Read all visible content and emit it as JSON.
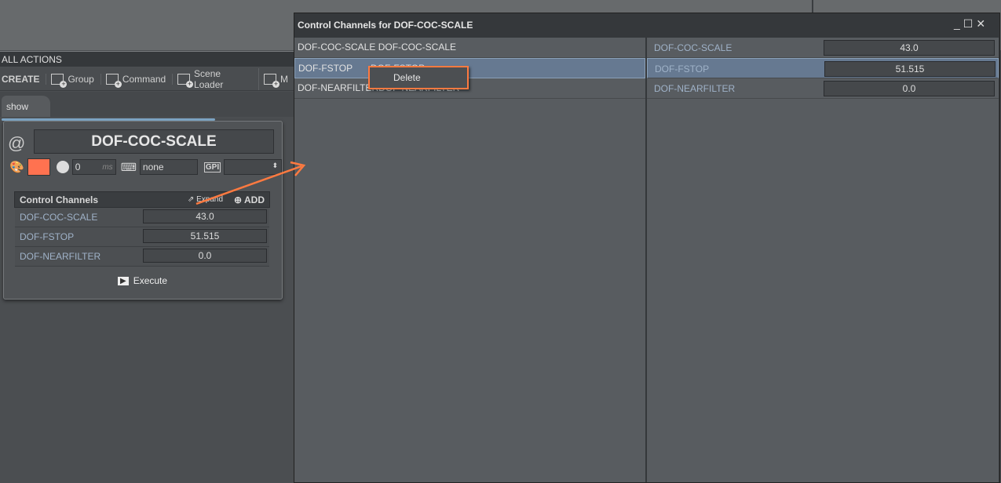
{
  "left": {
    "section_title": "ALL ACTIONS",
    "toolbar": {
      "create": "CREATE",
      "items": [
        {
          "label": "Group",
          "icon": "group-add-icon"
        },
        {
          "label": "Command",
          "icon": "command-add-icon"
        },
        {
          "label": "Scene Loader",
          "icon": "scene-loader-add-icon"
        },
        {
          "label": "M",
          "icon": "media-add-icon"
        }
      ]
    },
    "tab": "show",
    "card": {
      "title": "DOF-COC-SCALE",
      "color": "#ff7250",
      "delay": "0",
      "delay_unit": "ms",
      "shortcut": "none",
      "gpi_label": "GPI",
      "gpi_value": "",
      "channels_title": "Control Channels",
      "expand": "Expand",
      "add": "ADD",
      "channels": [
        {
          "name": "DOF-COC-SCALE",
          "value": "43.0"
        },
        {
          "name": "DOF-FSTOP",
          "value": "51.515"
        },
        {
          "name": "DOF-NEARFILTER",
          "value": "0.0"
        }
      ],
      "execute": "Execute"
    }
  },
  "dialog": {
    "title": "Control Channels for DOF-COC-SCALE",
    "left_rows": [
      {
        "a": "DOF-COC-SCALE",
        "b": "DOF-COC-SCALE"
      },
      {
        "a": "DOF-FSTOP",
        "b": "DOF-FSTOP"
      },
      {
        "a": "DOF-NEARFILTER",
        "b": "DOF-NEARFILTER"
      }
    ],
    "right_rows": [
      {
        "name": "DOF-COC-SCALE",
        "value": "43.0"
      },
      {
        "name": "DOF-FSTOP",
        "value": "51.515"
      },
      {
        "name": "DOF-NEARFILTER",
        "value": "0.0"
      }
    ],
    "selected_index": 1,
    "context_menu": {
      "item": "Delete"
    }
  },
  "annotation_color": "#ff7a40"
}
